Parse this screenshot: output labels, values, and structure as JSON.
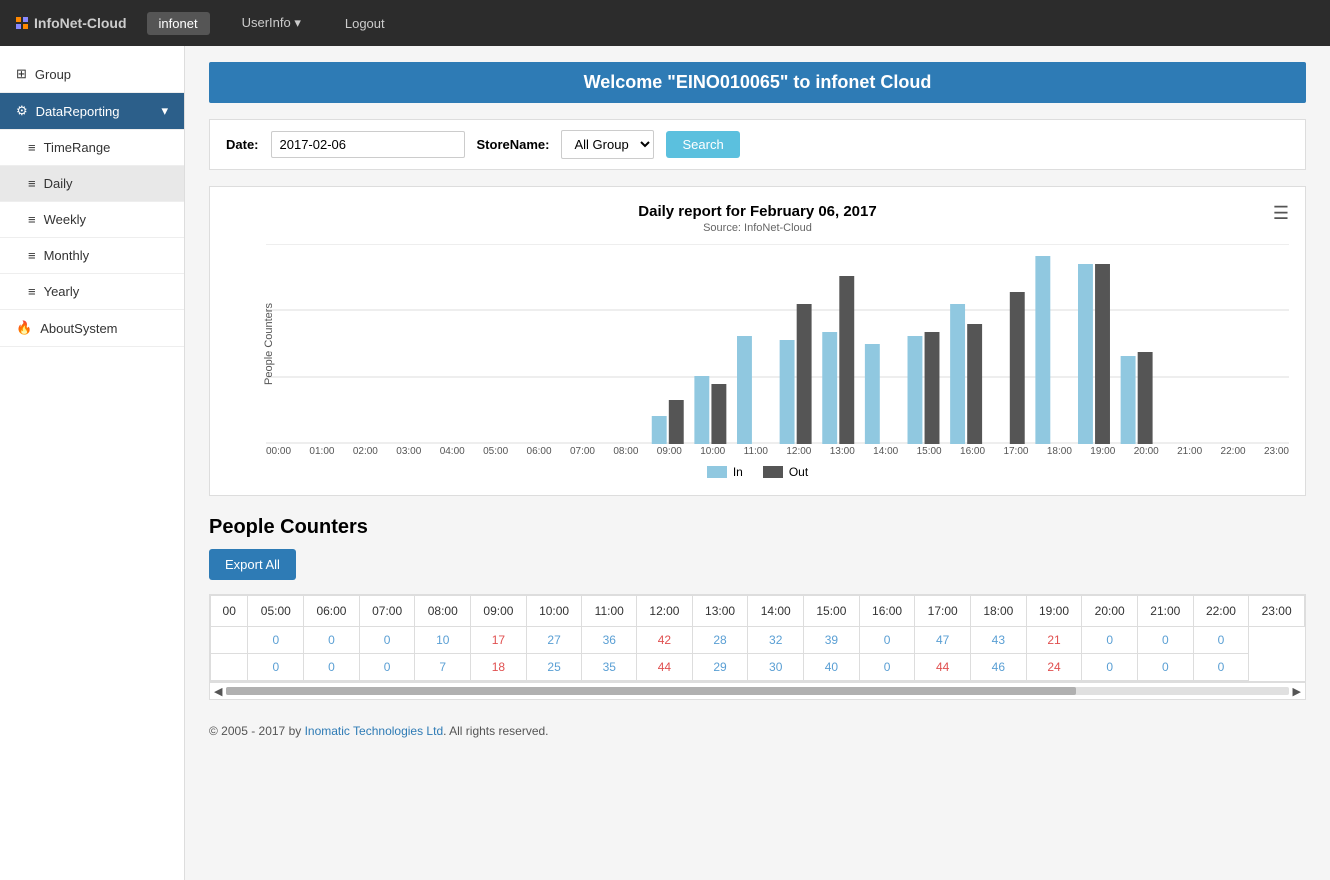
{
  "navbar": {
    "brand": "InfoNet-Cloud",
    "items": [
      {
        "label": "infonet",
        "active": true
      },
      {
        "label": "UserInfo ▾",
        "active": false
      },
      {
        "label": "Logout",
        "active": false
      }
    ]
  },
  "sidebar": {
    "items": [
      {
        "label": "Group",
        "icon": "⊞",
        "active": false,
        "highlighted": false
      },
      {
        "label": "DataReporting",
        "icon": "⚙",
        "active": true,
        "highlighted": false,
        "arrow": "▾"
      },
      {
        "label": "TimeRange",
        "icon": "≡",
        "active": false,
        "highlighted": false
      },
      {
        "label": "Daily",
        "icon": "≡",
        "active": false,
        "highlighted": true
      },
      {
        "label": "Weekly",
        "icon": "≡",
        "active": false,
        "highlighted": false
      },
      {
        "label": "Monthly",
        "icon": "≡",
        "active": false,
        "highlighted": false
      },
      {
        "label": "Yearly",
        "icon": "≡",
        "active": false,
        "highlighted": false
      },
      {
        "label": "AboutSystem",
        "icon": "🔥",
        "active": false,
        "highlighted": false
      }
    ]
  },
  "welcome": {
    "text": "Welcome \"EINO010065\" to infonet Cloud"
  },
  "filter": {
    "date_label": "Date:",
    "date_value": "2017-02-06",
    "store_label": "StoreName:",
    "store_value": "All Group",
    "store_options": [
      "All Group"
    ],
    "search_label": "Search"
  },
  "chart": {
    "title": "Daily report for February 06, 2017",
    "source": "Source: InfoNet-Cloud",
    "legend_in": "In",
    "legend_out": "Out",
    "hours": [
      "00:00",
      "01:00",
      "02:00",
      "03:00",
      "04:00",
      "05:00",
      "06:00",
      "07:00",
      "08:00",
      "09:00",
      "10:00",
      "11:00",
      "12:00",
      "13:00",
      "14:00",
      "15:00",
      "16:00",
      "17:00",
      "18:00",
      "19:00",
      "20:00",
      "21:00",
      "22:00",
      "23:00"
    ],
    "in_values": [
      0,
      0,
      0,
      0,
      0,
      0,
      0,
      0,
      0,
      7,
      17,
      27,
      26,
      28,
      25,
      27,
      35,
      0,
      47,
      45,
      22,
      0,
      0,
      0
    ],
    "out_values": [
      0,
      0,
      0,
      0,
      0,
      0,
      0,
      0,
      0,
      11,
      15,
      0,
      35,
      42,
      0,
      28,
      30,
      38,
      0,
      45,
      23,
      0,
      0,
      0
    ]
  },
  "people_counters": {
    "title": "People Counters",
    "export_label": "Export All",
    "headers": [
      "05:00",
      "06:00",
      "07:00",
      "08:00",
      "09:00",
      "10:00",
      "11:00",
      "12:00",
      "13:00",
      "14:00",
      "15:00",
      "16:00",
      "17:00",
      "18:00",
      "19:00",
      "20:00",
      "21:00",
      "22:00",
      "23:00"
    ],
    "rows": [
      {
        "cells": [
          0,
          0,
          0,
          10,
          17,
          27,
          36,
          42,
          28,
          32,
          39,
          0,
          47,
          43,
          21,
          0,
          0,
          0
        ]
      },
      {
        "cells": [
          0,
          0,
          0,
          7,
          18,
          25,
          35,
          44,
          29,
          30,
          40,
          0,
          44,
          46,
          24,
          0,
          0,
          0
        ]
      }
    ]
  },
  "footer": {
    "text": "© 2005 - 2017 by Inomatic Technologies Ltd. All rights reserved."
  }
}
